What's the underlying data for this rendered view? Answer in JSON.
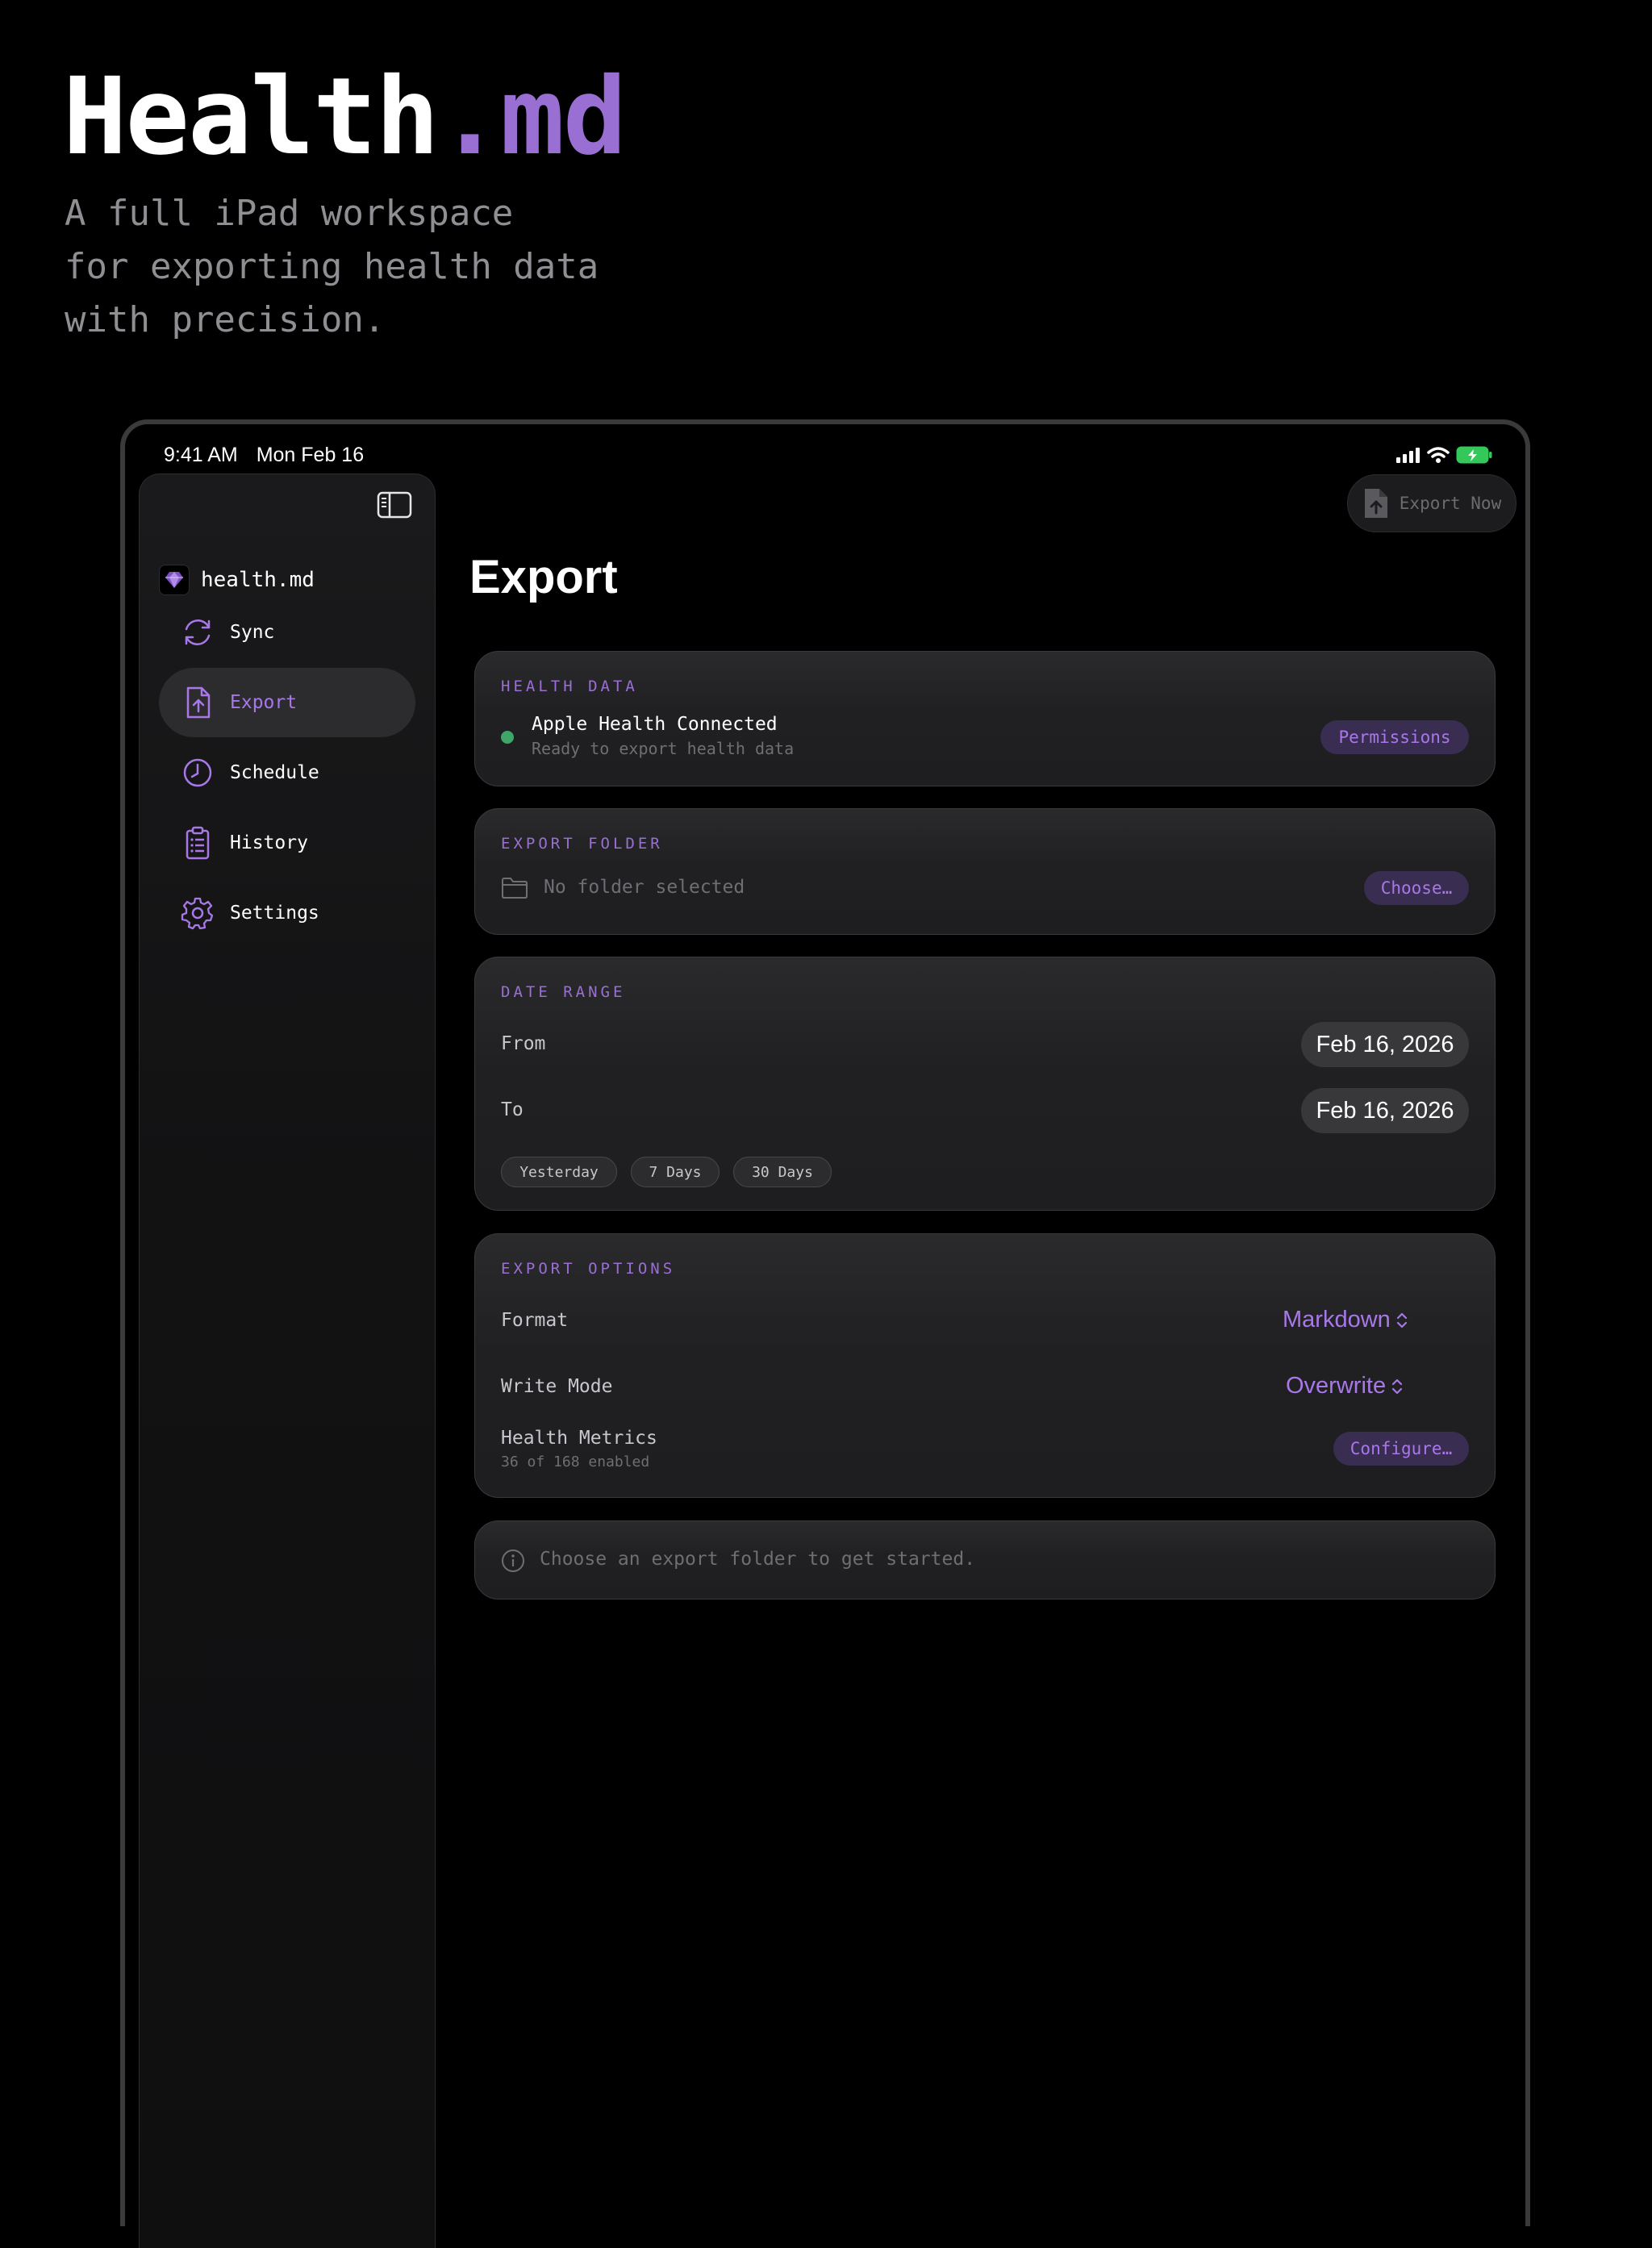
{
  "hero": {
    "title_main": "Health",
    "title_accent": ".md",
    "subtitle": "A full iPad workspace\nfor exporting health data\nwith precision."
  },
  "status_bar": {
    "time": "9:41 AM",
    "date": "Mon Feb 16"
  },
  "sidebar": {
    "app_name": "health.md",
    "items": [
      {
        "label": "Sync",
        "icon": "sync-icon"
      },
      {
        "label": "Export",
        "icon": "export-document-icon",
        "active": true
      },
      {
        "label": "Schedule",
        "icon": "clock-icon"
      },
      {
        "label": "History",
        "icon": "clipboard-list-icon"
      },
      {
        "label": "Settings",
        "icon": "gear-icon"
      }
    ]
  },
  "toolbar": {
    "export_now_label": "Export Now"
  },
  "page": {
    "title": "Export"
  },
  "health_data": {
    "label": "HEALTH DATA",
    "status_title": "Apple Health Connected",
    "status_subtitle": "Ready to export health data",
    "permissions_label": "Permissions"
  },
  "export_folder": {
    "label": "EXPORT FOLDER",
    "placeholder": "No folder selected",
    "choose_label": "Choose…"
  },
  "date_range": {
    "label": "DATE RANGE",
    "from_label": "From",
    "from_value": "Feb 16, 2026",
    "to_label": "To",
    "to_value": "Feb 16, 2026",
    "presets": [
      "Yesterday",
      "7 Days",
      "30 Days"
    ]
  },
  "export_options": {
    "label": "EXPORT OPTIONS",
    "format_label": "Format",
    "format_value": "Markdown",
    "write_mode_label": "Write Mode",
    "write_mode_value": "Overwrite",
    "metrics_label": "Health Metrics",
    "metrics_sub": "36 of 168 enabled",
    "configure_label": "Configure…"
  },
  "info": {
    "message": "Choose an export folder to get started."
  },
  "colors": {
    "accent": "#9a6fd4",
    "accent_bright": "#a878e8",
    "status_green": "#3fa66a",
    "battery_green": "#34c759"
  }
}
